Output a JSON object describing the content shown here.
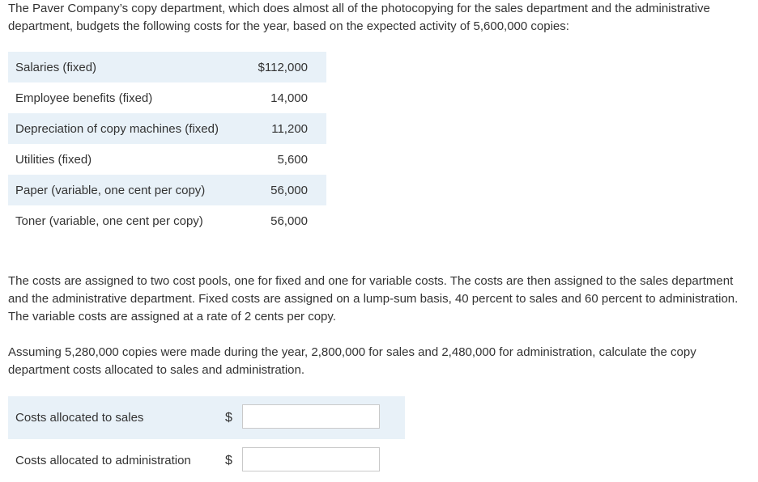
{
  "intro_text": "The Paver Company’s copy department, which does almost all of the photocopying for the sales department and the administrative department, budgets the following costs for the year, based on the expected activity of 5,600,000 copies:",
  "costs": [
    {
      "label": "Salaries (fixed)",
      "amount": "$112,000"
    },
    {
      "label": "Employee benefits (fixed)",
      "amount": "14,000"
    },
    {
      "label": "Depreciation of copy machines (fixed)",
      "amount": "11,200"
    },
    {
      "label": "Utilities (fixed)",
      "amount": "5,600"
    },
    {
      "label": "Paper (variable, one cent per copy)",
      "amount": "56,000"
    },
    {
      "label": "Toner (variable, one cent per copy)",
      "amount": "56,000"
    }
  ],
  "pools_text": "The costs are assigned to two cost pools, one for fixed and one for variable costs. The costs are then assigned to the sales department and the administrative department. Fixed costs are assigned on a lump-sum basis, 40 percent to sales and 60 percent to administration. The variable costs are assigned at a rate of 2 cents per copy.",
  "question_text": "Assuming 5,280,000 copies were made during the year, 2,800,000 for sales and 2,480,000 for administration, calculate the copy department costs allocated to sales and administration.",
  "answers": [
    {
      "label": "Costs allocated to sales",
      "currency": "$",
      "value": ""
    },
    {
      "label": "Costs allocated to administration",
      "currency": "$",
      "value": ""
    }
  ],
  "colors": {
    "row_shade": "#e8f1f8",
    "text": "#333333",
    "input_border": "#c9c9c9"
  }
}
